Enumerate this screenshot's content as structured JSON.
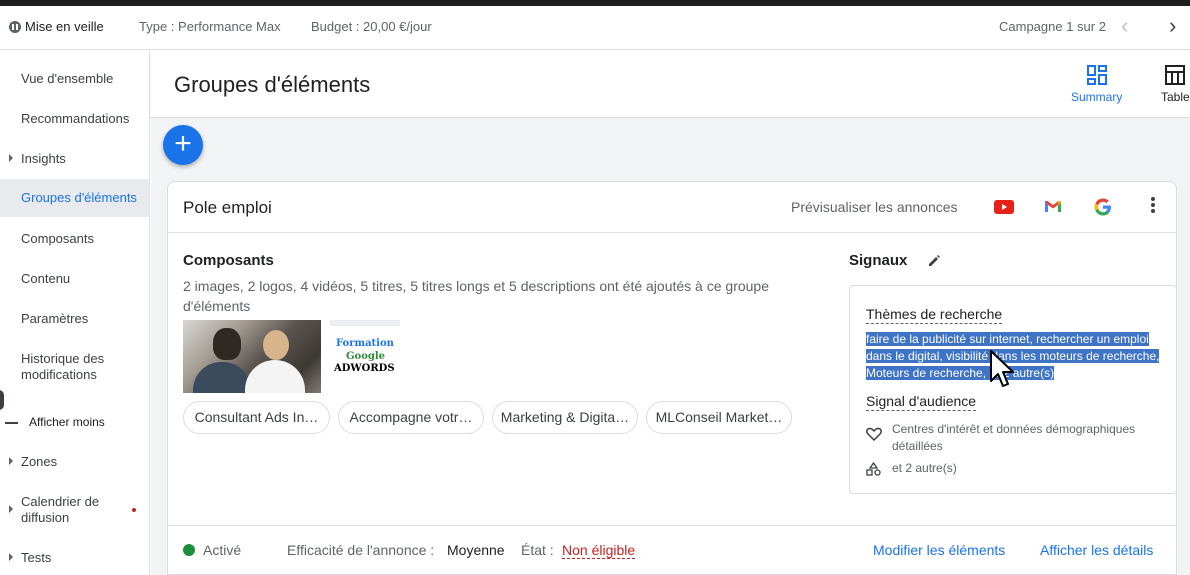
{
  "topbar": {
    "status": "Mise en veille",
    "type": "Type : Performance Max",
    "budget": "Budget : 20,00 €/jour",
    "campaign_pager": "Campagne 1 sur 2"
  },
  "sidebar": {
    "items": [
      {
        "label": "Vue d'ensemble"
      },
      {
        "label": "Recommandations"
      },
      {
        "label": "Insights"
      },
      {
        "label": "Groupes d'éléments"
      },
      {
        "label": "Composants"
      },
      {
        "label": "Contenu"
      },
      {
        "label": "Paramètres"
      },
      {
        "label": "Historique des modifications"
      },
      {
        "label": "Afficher moins"
      },
      {
        "label": "Zones"
      },
      {
        "label": "Calendrier de diffusion"
      },
      {
        "label": "Tests"
      }
    ]
  },
  "header": {
    "title": "Groupes d'éléments",
    "views": [
      "Summary",
      "Table"
    ]
  },
  "card": {
    "title": "Pole emploi",
    "preview": "Prévisualiser les annonces",
    "components_title": "Composants",
    "components_desc": "2 images, 2 logos, 4 vidéos, 5 titres, 5 titres longs et 5 descriptions ont été ajoutés à ce groupe d'éléments",
    "logo_lines": [
      "Formation",
      "Google",
      "ADWORDS"
    ],
    "chips": [
      "Consultant Ads In…",
      "Accompagne votr…",
      "Marketing & Digita…",
      "MLConseil Market…"
    ],
    "signals_title": "Signaux",
    "search_themes_label": "Thèmes de recherche",
    "search_themes": "faire de la publicité sur internet, rechercher un emploi dans le digital, visibilité dans les moteurs de recherche, Moteurs de recherche, et 2 autre(s)",
    "audience_label": "Signal d'audience",
    "audience_interests": "Centres d'intérêt et données démographiques détaillées",
    "audience_others": "et 2 autre(s)"
  },
  "footer": {
    "status": "Activé",
    "efficacy_label": "Efficacité de l'annonce :",
    "efficacy_value": "Moyenne",
    "state_label": "État :",
    "state_value": "Non éligible",
    "edit_link": "Modifier les éléments",
    "details_link": "Afficher les détails"
  },
  "colors": {
    "accent": "#1a73e8",
    "active_green": "#1e8e3e",
    "warning_red": "#c5221f",
    "selection": "#3f73c6"
  }
}
